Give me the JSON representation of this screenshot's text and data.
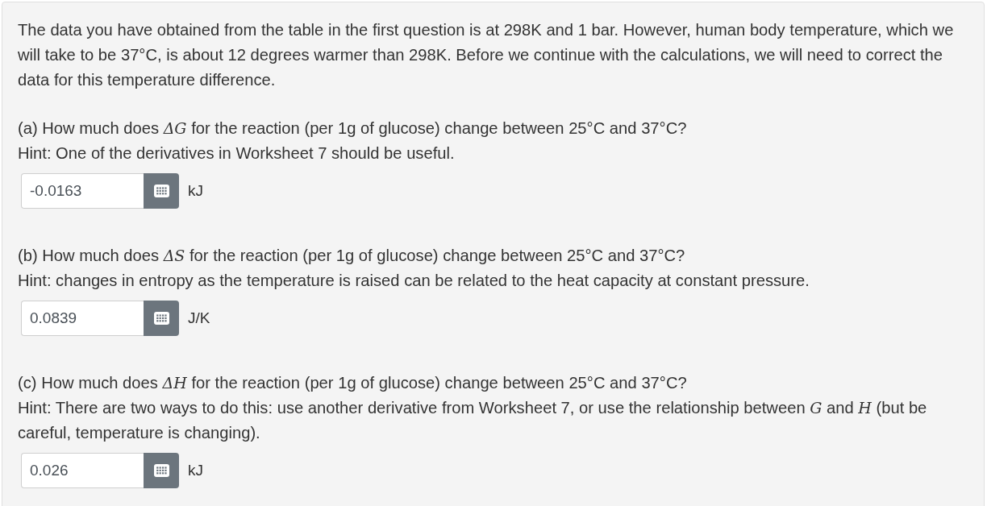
{
  "intro": "The data you have obtained from the table in the first question is at 298K and 1 bar. However, human body temperature, which we will take to be 37°C, is about 12 degrees warmer than 298K. Before we continue with the calculations, we will need to correct the data for this temperature difference.",
  "questions": [
    {
      "label": "(a) How much does *ΔG* for the reaction (per 1g of glucose) change between 25°C and 37°C?",
      "hint": "Hint: One of the derivatives in Worksheet 7 should be useful.",
      "answer": {
        "value": "-0.0163",
        "unit": "kJ"
      }
    },
    {
      "label": "(b) How much does *ΔS* for the reaction (per 1g of glucose) change between 25°C and 37°C?",
      "hint": "Hint: changes in entropy as the temperature is raised can be related to the heat capacity at constant pressure.",
      "answer": {
        "value": "0.0839",
        "unit": "J/K"
      }
    },
    {
      "label": "(c) How much does *ΔH* for the reaction (per 1g of glucose) change between 25°C and 37°C?",
      "hint": "Hint: There are two ways to do this: use another derivative from Worksheet 7, or use the relationship between *G* and *H* (but be careful, temperature is changing).",
      "answer": {
        "value": "0.026",
        "unit": "kJ"
      }
    }
  ]
}
